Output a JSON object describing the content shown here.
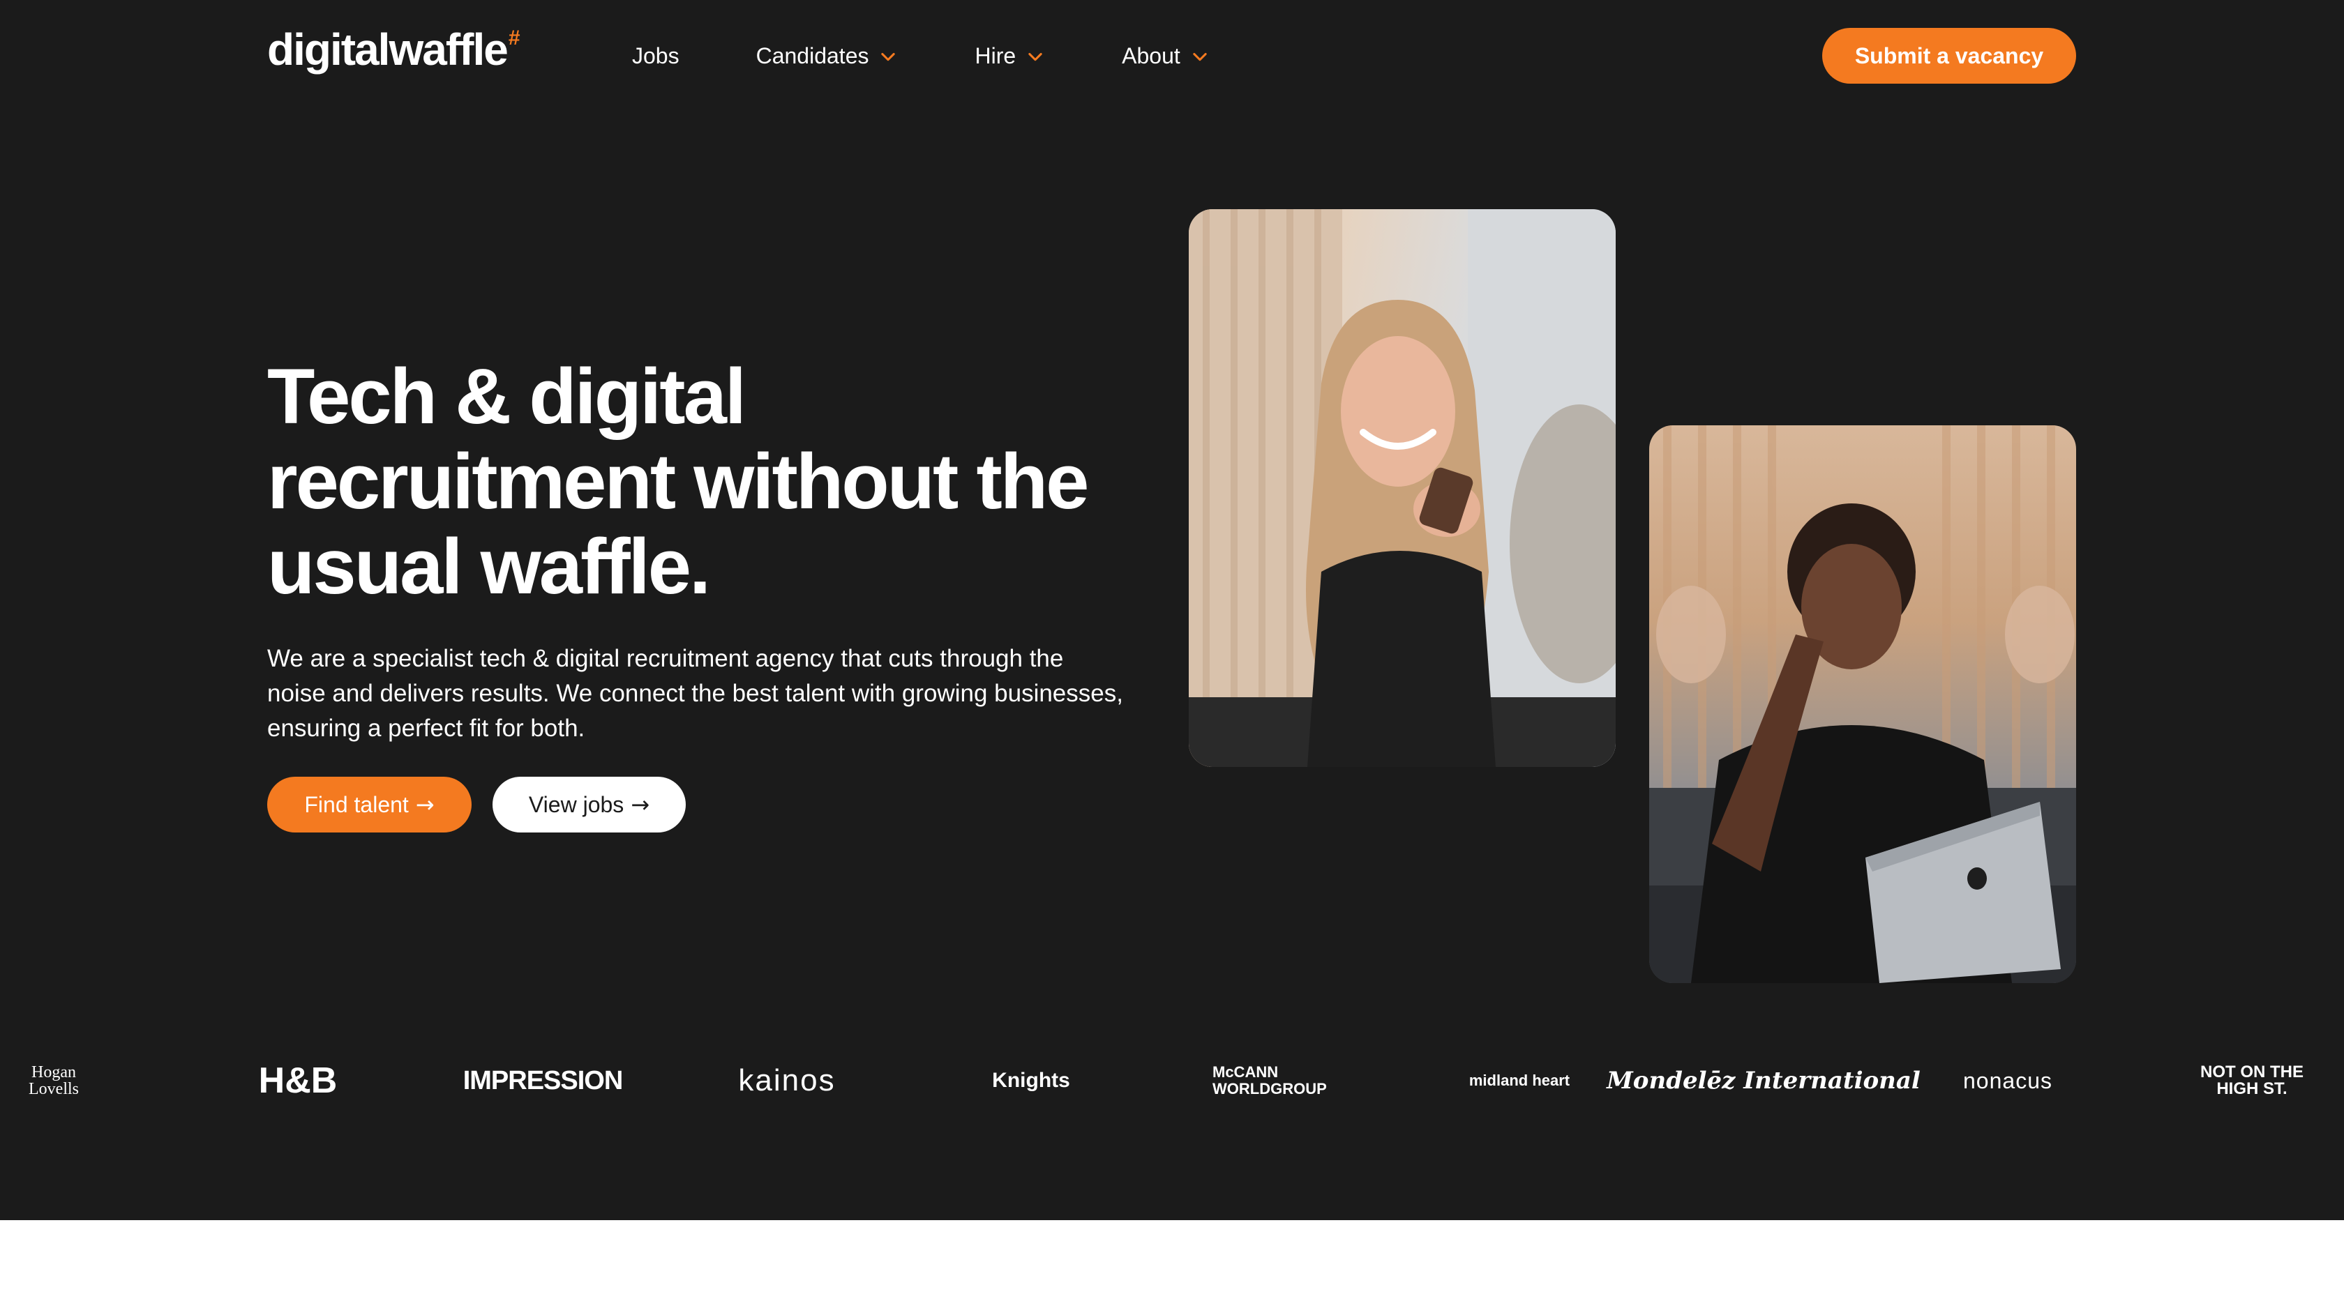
{
  "brand": {
    "logo_text": "digitalwaffle",
    "logo_mark": "#",
    "accent_color": "#f47a20",
    "background_color": "#1b1b1b"
  },
  "nav": {
    "items": [
      {
        "label": "Jobs",
        "has_dropdown": false
      },
      {
        "label": "Candidates",
        "has_dropdown": true
      },
      {
        "label": "Hire",
        "has_dropdown": true
      },
      {
        "label": "About",
        "has_dropdown": true
      }
    ],
    "cta_label": "Submit a vacancy"
  },
  "hero": {
    "title_lines": [
      "Tech & digital",
      "recruitment without the",
      "usual waffle."
    ],
    "description": "We are a specialist tech & digital recruitment agency that cuts through the noise and delivers results. We connect the best talent with growing businesses, ensuring a perfect fit for both.",
    "primary_cta": "Find talent",
    "secondary_cta": "View jobs",
    "arrow_icon": "arrow-right-icon"
  },
  "clients": [
    "Hogan Lovells",
    "H&B",
    "IMPRESSION",
    "kainos",
    "Knights",
    "McCANN WORLDGROUP",
    "midland heart",
    "Mondelēz International",
    "nonacus",
    "NOT ON THE HIGH ST."
  ]
}
